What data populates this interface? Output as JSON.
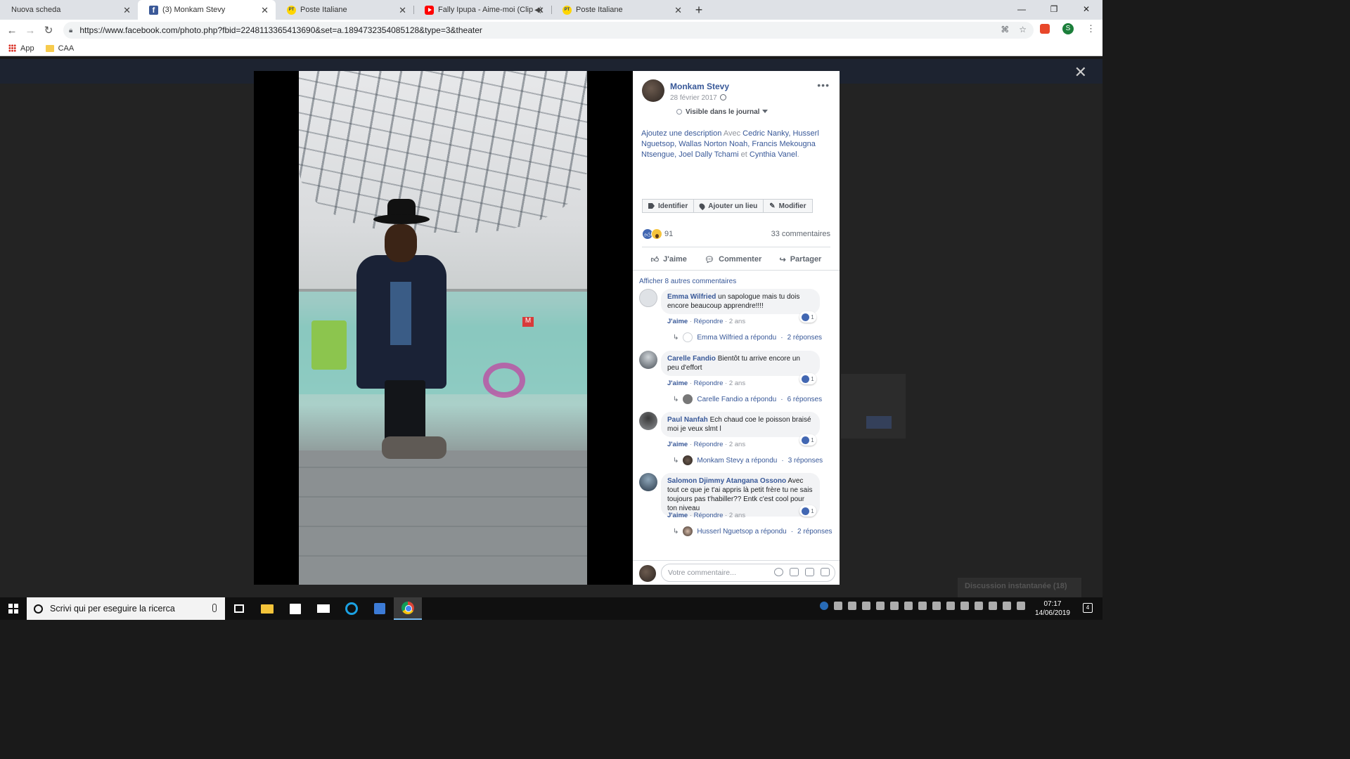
{
  "browser": {
    "tabs": [
      {
        "title": "Nuova scheda",
        "icon": "none",
        "active": false
      },
      {
        "title": "(3) Monkam Stevy",
        "icon": "facebook-icon",
        "active": true
      },
      {
        "title": "Poste Italiane",
        "icon": "poste-icon",
        "active": false
      },
      {
        "title": "Fally Ipupa - Aime-moi (Clip",
        "icon": "youtube-icon",
        "active": false
      },
      {
        "title": "Poste Italiane",
        "icon": "poste-icon",
        "active": false
      }
    ],
    "url": "https://www.facebook.com/photo.php?fbid=2248113365413690&set=a.1894732354085128&type=3&theater",
    "profile_initial": "S",
    "bookmarks": [
      {
        "label": "App",
        "icon": "apps-grid-icon"
      },
      {
        "label": "CAA",
        "icon": "folder-icon"
      }
    ]
  },
  "post": {
    "author": "Monkam Stevy",
    "date": "28 février 2017",
    "visibility": "Visible dans le journal",
    "desc_prefix": "Ajoutez une description",
    "desc_with": "Avec",
    "tagged": [
      "Cedric Nanky",
      "Husserl Nguetsop",
      "Wallas Norton Noah",
      "Francis Mekougna Ntsengue",
      "Joel Dally Tchami",
      "Cynthia Vanel"
    ],
    "desc_and": "et",
    "actions": {
      "tag": "Identifier",
      "place": "Ajouter un lieu",
      "edit": "Modifier"
    },
    "reaction_count": "91",
    "comment_count": "33 commentaires",
    "buttons": {
      "like": "J'aime",
      "comment": "Commenter",
      "share": "Partager"
    },
    "more_comments": "Afficher 8 autres commentaires",
    "comment_placeholder": "Votre commentaire..."
  },
  "comments": [
    {
      "author": "Emma Wilfried",
      "text": "un sapologue mais tu dois encore beaucoup apprendre!!!!",
      "likes": "1",
      "like": "J'aime",
      "reply": "Répondre",
      "age": "2 ans",
      "replied_by": "Emma Wilfried a répondu",
      "replies": "2 réponses"
    },
    {
      "author": "Carelle Fandio",
      "text": "Bientôt tu arrive encore un peu d'effort",
      "likes": "1",
      "like": "J'aime",
      "reply": "Répondre",
      "age": "2 ans",
      "replied_by": "Carelle Fandio a répondu",
      "replies": "6 réponses"
    },
    {
      "author": "Paul Nanfah",
      "text": "Ech chaud coe le poisson braisé moi je veux slmt l",
      "likes": "1",
      "like": "J'aime",
      "reply": "Répondre",
      "age": "2 ans",
      "replied_by": "Monkam Stevy a répondu",
      "replies": "3 réponses"
    },
    {
      "author": "Salomon Djimmy Atangana Ossono",
      "text": "Avec tout ce que je t'ai appris là petit frère tu ne sais toujours pas t'habiller?? Entk c'est cool pour ton niveau",
      "likes": "1",
      "like": "J'aime",
      "reply": "Répondre",
      "age": "2 ans",
      "replied_by": "Husserl Nguetsop a répondu",
      "replies": "2 réponses"
    }
  ],
  "background": {
    "chat_label": "Discussion instantanée (18)"
  },
  "taskbar": {
    "search_placeholder": "Scrivi qui per eseguire la ricerca",
    "time": "07:17",
    "date": "14/06/2019",
    "notifications": "4"
  }
}
